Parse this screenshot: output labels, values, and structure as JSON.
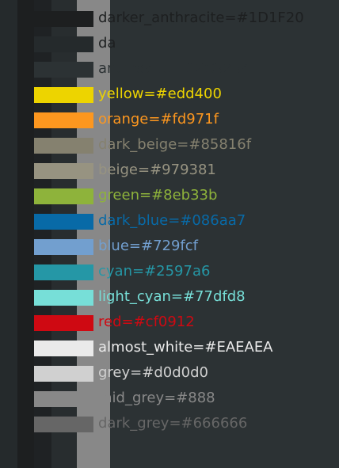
{
  "colors": [
    {
      "label": "darker_anthracite=#1D1F20",
      "swatch": "#1D1F20",
      "text_color": "#1D1F20"
    },
    {
      "label": "da",
      "swatch": "#252a2c",
      "text_color": "#1D1F20"
    },
    {
      "label": "anthracite=#2C3234",
      "swatch": "#2C3234",
      "text_color": "#2C3234"
    },
    {
      "label": "yellow=#edd400",
      "swatch": "#edd400",
      "text_color": "#edd400"
    },
    {
      "label": "orange=#fd971f",
      "swatch": "#fd971f",
      "text_color": "#fd971f"
    },
    {
      "label": "dark_beige=#85816f",
      "swatch": "#85816f",
      "text_color": "#85816f"
    },
    {
      "label": "beige=#979381",
      "swatch": "#979381",
      "text_color": "#979381"
    },
    {
      "label": "green=#8eb33b",
      "swatch": "#8eb33b",
      "text_color": "#8eb33b"
    },
    {
      "label": "dark_blue=#086aa7",
      "swatch": "#086aa7",
      "text_color": "#086aa7"
    },
    {
      "label": "blue=#729fcf",
      "swatch": "#729fcf",
      "text_color": "#729fcf"
    },
    {
      "label": "cyan=#2597a6",
      "swatch": "#2597a6",
      "text_color": "#2597a6"
    },
    {
      "label": "light_cyan=#77dfd8",
      "swatch": "#77dfd8",
      "text_color": "#77dfd8"
    },
    {
      "label": "red=#cf0912",
      "swatch": "#cf0912",
      "text_color": "#cf0912"
    },
    {
      "label": "almost_white=#EAEAEA",
      "swatch": "#EAEAEA",
      "text_color": "#EAEAEA"
    },
    {
      "label": "grey=#d0d0d0",
      "swatch": "#d0d0d0",
      "text_color": "#d0d0d0"
    },
    {
      "label": "mid_grey=#888",
      "swatch": "#888888",
      "text_color": "#888888"
    },
    {
      "label": "dark_grey=#666666",
      "swatch": "#666666",
      "text_color": "#666666"
    }
  ]
}
